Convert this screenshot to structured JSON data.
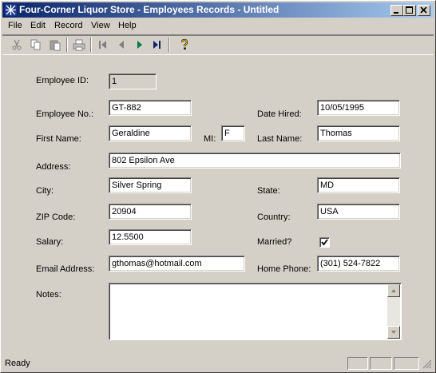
{
  "window": {
    "title": "Four-Corner Liquor Store - Employees Records - Untitled"
  },
  "menu": {
    "items": [
      "File",
      "Edit",
      "Record",
      "View",
      "Help"
    ]
  },
  "toolbar": {
    "buttons": [
      "cut-icon",
      "copy-icon",
      "paste-icon",
      "print-icon",
      "first-record-icon",
      "previous-record-icon",
      "next-record-icon",
      "last-record-icon",
      "help-icon"
    ]
  },
  "form": {
    "employee_id": {
      "label": "Employee ID:",
      "value": "1"
    },
    "employee_no": {
      "label": "Employee No.:",
      "value": "GT-882"
    },
    "date_hired": {
      "label": "Date Hired:",
      "value": "10/05/1995"
    },
    "first_name": {
      "label": "First Name:",
      "value": "Geraldine"
    },
    "mi": {
      "label": "MI:",
      "value": "F"
    },
    "last_name": {
      "label": "Last Name:",
      "value": "Thomas"
    },
    "address": {
      "label": "Address:",
      "value": "802 Epsilon Ave"
    },
    "city": {
      "label": "City:",
      "value": "Silver Spring"
    },
    "state": {
      "label": "State:",
      "value": "MD"
    },
    "zip": {
      "label": "ZIP Code:",
      "value": "20904"
    },
    "country": {
      "label": "Country:",
      "value": "USA"
    },
    "salary": {
      "label": "Salary:",
      "value": "12.5500"
    },
    "married": {
      "label": "Married?",
      "checked": true
    },
    "email": {
      "label": "Email Address:",
      "value": "gthomas@hotmail.com"
    },
    "home_phone": {
      "label": "Home Phone:",
      "value": "(301) 524-7822"
    },
    "notes": {
      "label": "Notes:",
      "value": ""
    }
  },
  "status": {
    "text": "Ready"
  }
}
